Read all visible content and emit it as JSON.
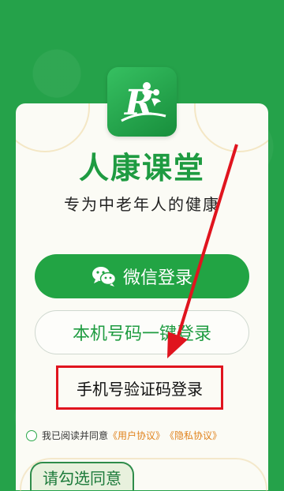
{
  "brand": {
    "name": "人康课堂",
    "slogan": "专为中老年人的健康",
    "logo_icon": "renkang-logo-icon"
  },
  "buttons": {
    "wechat_label": "微信登录",
    "wechat_icon": "wechat-icon",
    "phone_label": "本机号码一键登录",
    "sms_label": "手机号验证码登录"
  },
  "agreement": {
    "prefix": "我已阅读并同意",
    "user_agreement": "《用户协议》",
    "privacy_policy": "《隐私协议》"
  },
  "toast": {
    "text": "请勾选同意"
  },
  "colors": {
    "background": "#25a24a",
    "brand_green": "#1e9b41",
    "wechat_button": "#22a444",
    "highlight_red": "#e0141e",
    "link_orange": "#e0821c"
  }
}
